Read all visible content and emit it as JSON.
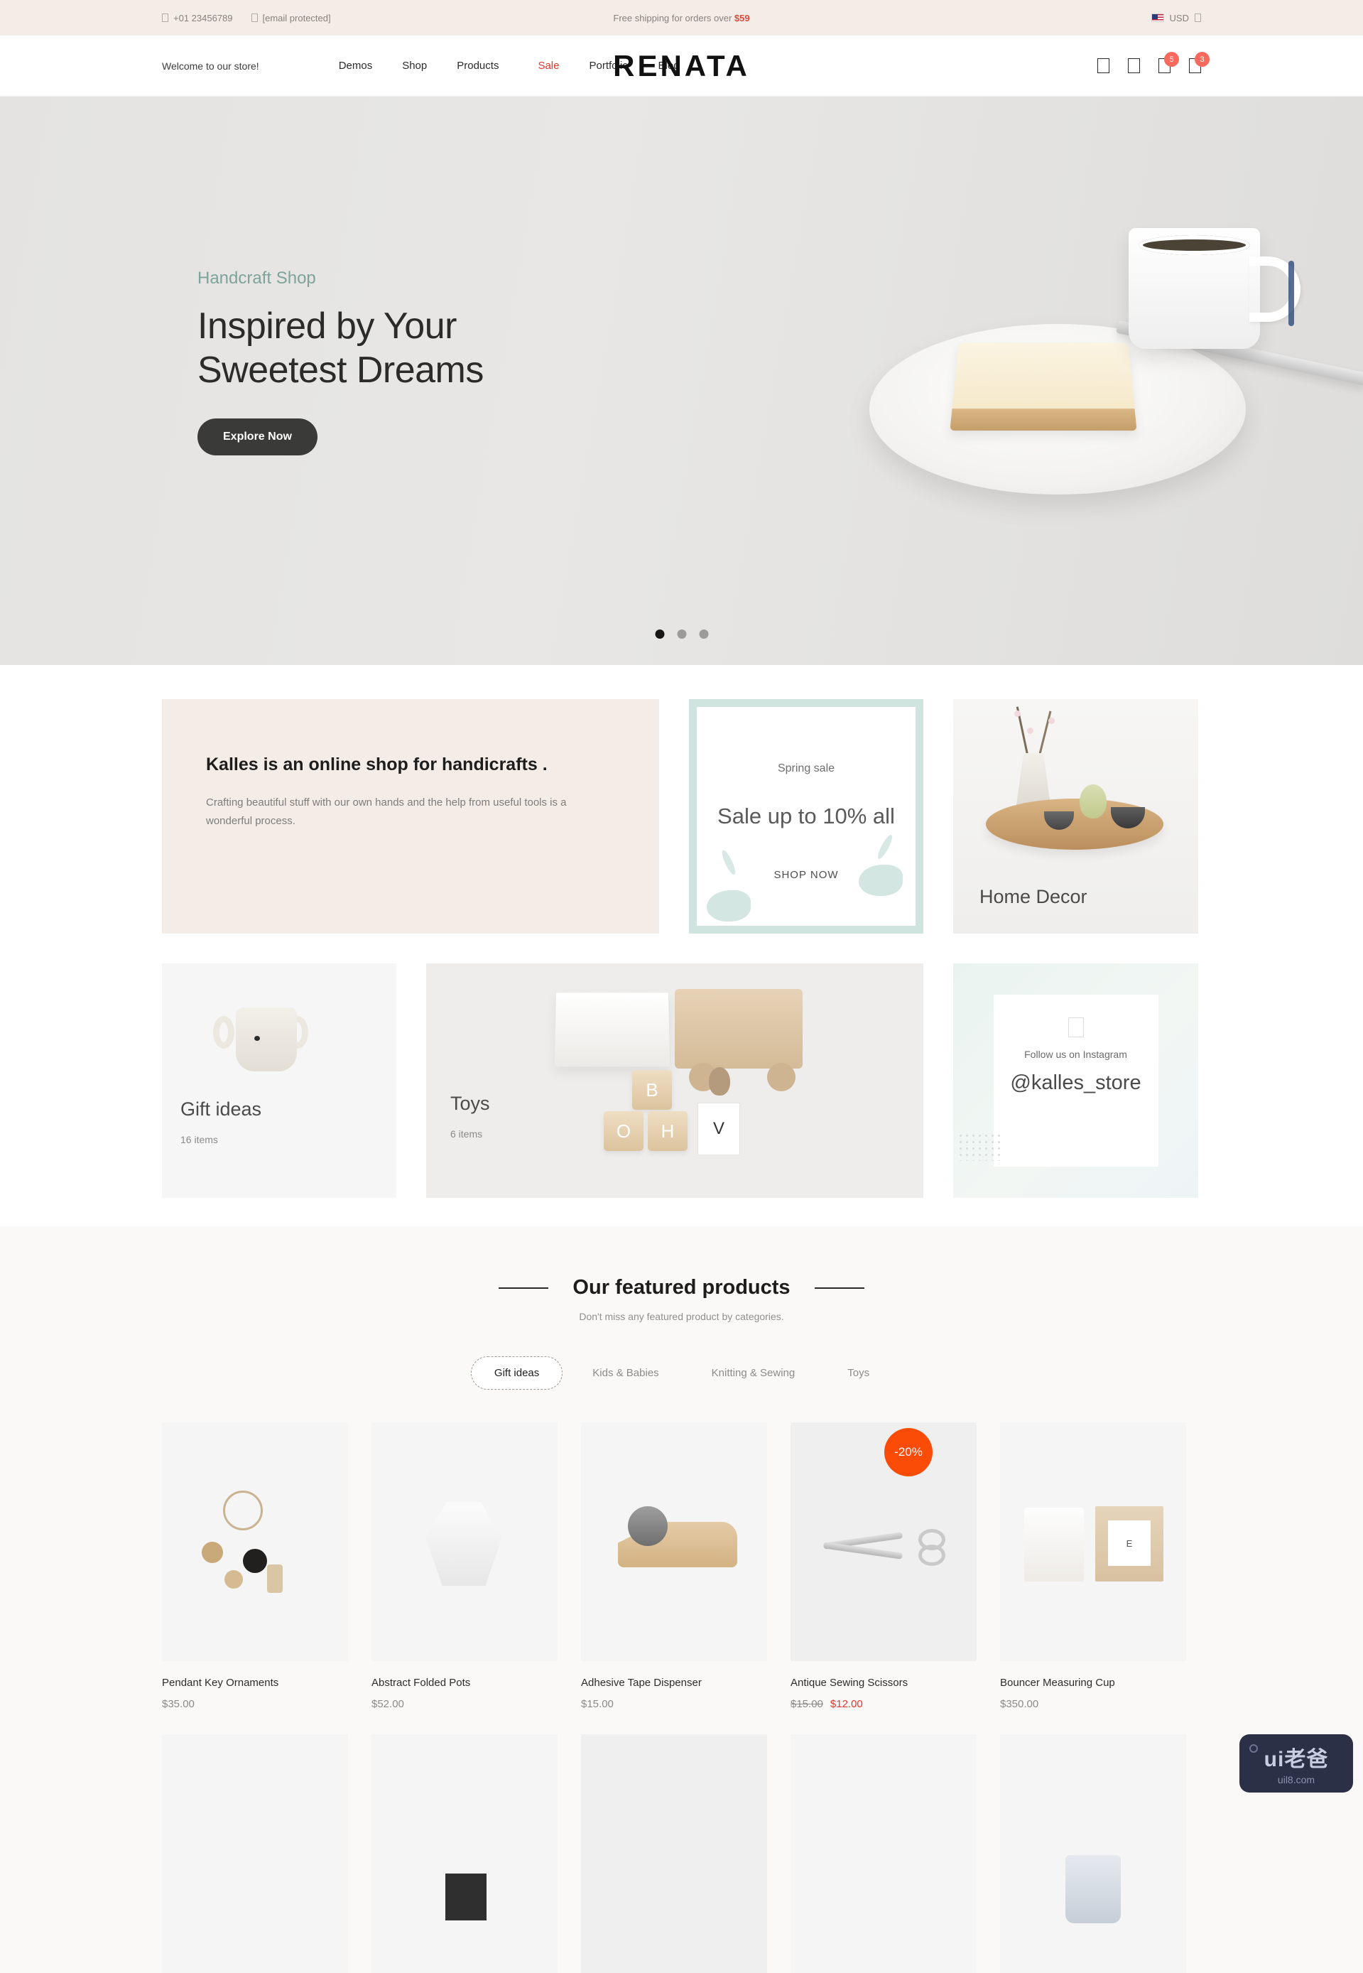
{
  "topbar": {
    "phone": "+01 23456789",
    "email": "[email protected]",
    "shipping_prefix": "Free shipping for orders over ",
    "shipping_amount": "$59",
    "currency": "USD",
    "phone_icon": "phone-icon",
    "email_icon": "envelope-icon",
    "chevron_icon": "chevron-down-icon",
    "flag_icon": "us-flag-icon"
  },
  "header": {
    "welcome": "Welcome to our store!",
    "brand": "RENATA",
    "nav_left": [
      {
        "label": "Demos"
      },
      {
        "label": "Shop"
      },
      {
        "label": "Products"
      }
    ],
    "nav_right": [
      {
        "label": "Sale",
        "accent": true
      },
      {
        "label": "Portfolio"
      },
      {
        "label": "Blog"
      }
    ],
    "icons": [
      {
        "name": "search-icon",
        "badge": ""
      },
      {
        "name": "user-account-icon",
        "badge": ""
      },
      {
        "name": "wishlist-heart-icon",
        "badge": "5"
      },
      {
        "name": "shopping-cart-icon",
        "badge": "3"
      }
    ]
  },
  "hero": {
    "eyebrow": "Handcraft Shop",
    "title_line1": "Inspired by Your",
    "title_line2": "Sweetest Dreams",
    "button": "Explore Now",
    "slide_count": 3,
    "active_slide": 1,
    "accent_color": "#7ea39c"
  },
  "promo": {
    "text_card": {
      "heading": "Kalles is an online shop for handicrafts .",
      "body": "Crafting beautiful stuff with our own hands and the help from useful tools is a wonderful process."
    },
    "spring": {
      "kicker": "Spring sale",
      "headline": "Sale up to 10% all",
      "cta": "SHOP NOW"
    },
    "home_decor": {
      "label": "Home Decor"
    },
    "gift_ideas": {
      "label": "Gift ideas",
      "count": "16 items"
    },
    "toys": {
      "label": "Toys",
      "count": "6 items"
    },
    "instagram": {
      "icon": "instagram-icon",
      "follow": "Follow us on Instagram",
      "handle": "@kalles_store"
    }
  },
  "featured": {
    "title": "Our featured products",
    "subtitle": "Don't miss any featured product by categories.",
    "tabs": [
      {
        "label": "Gift ideas",
        "active": true
      },
      {
        "label": "Kids & Babies",
        "active": false
      },
      {
        "label": "Knitting & Sewing",
        "active": false
      },
      {
        "label": "Toys",
        "active": false
      }
    ],
    "products": [
      {
        "name": "Pendant Key Ornaments",
        "price": "$35.00",
        "old_price": "",
        "sale_badge": ""
      },
      {
        "name": "Abstract Folded Pots",
        "price": "$52.00",
        "old_price": "",
        "sale_badge": ""
      },
      {
        "name": "Adhesive Tape Dispenser",
        "price": "$15.00",
        "old_price": "",
        "sale_badge": ""
      },
      {
        "name": "Antique Sewing Scissors",
        "price": "$12.00",
        "old_price": "$15.00",
        "sale_badge": "-20%"
      },
      {
        "name": "Bouncer Measuring Cup",
        "price": "$350.00",
        "old_price": "",
        "sale_badge": ""
      }
    ],
    "badge_color": "#fb4c07",
    "sale_price_color": "#e8352b"
  },
  "watermark": {
    "main": "ui老爸",
    "sub": "uil8.com"
  }
}
